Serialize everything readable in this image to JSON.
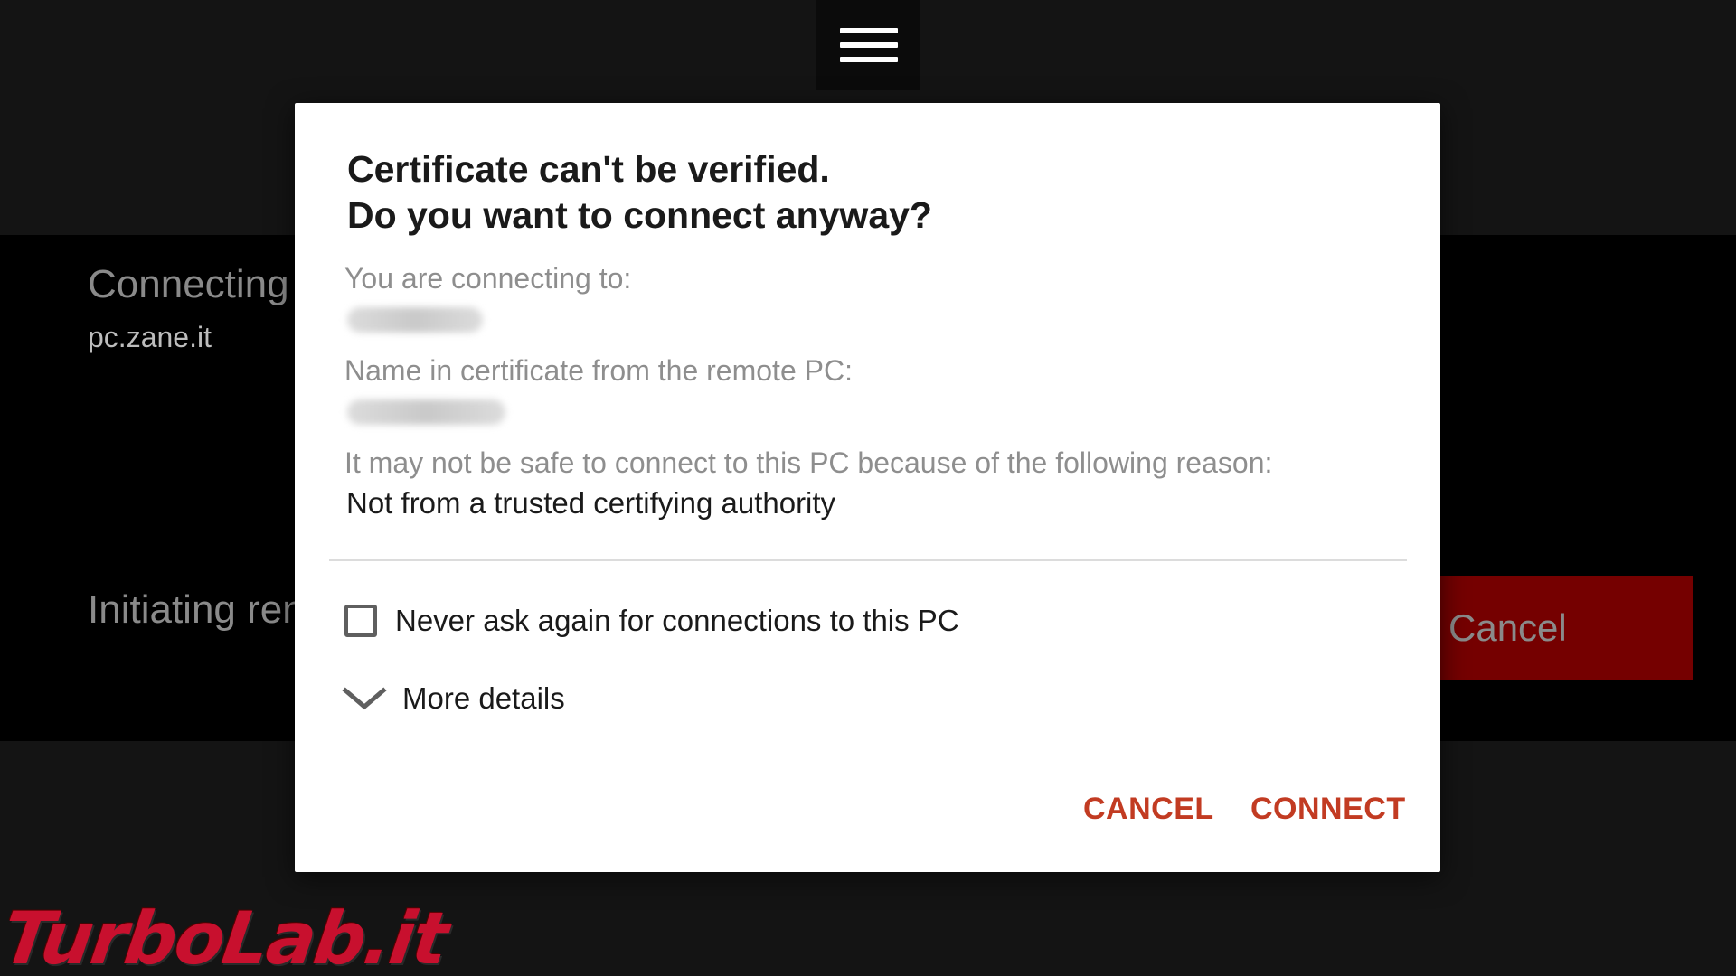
{
  "background": {
    "status_title": "Connecting",
    "status_host": "pc.zane.it",
    "status_progress": "Initiating ren",
    "cancel_label": "Cancel",
    "menu_icon": "hamburger-menu-icon"
  },
  "dialog": {
    "title_line1": "Certificate can't be verified.",
    "title_line2": "Do you want to connect anyway?",
    "connecting_to_label": "You are connecting to:",
    "cert_name_label": "Name in certificate from the remote PC:",
    "reason_label": "It may not be safe to connect to this PC because of the following reason:",
    "reason_value": "Not from a trusted certifying authority",
    "never_ask_label": "Never ask again for connections to this PC",
    "never_ask_checked": false,
    "more_details_label": "More details",
    "cancel_button": "CANCEL",
    "connect_button": "CONNECT"
  },
  "watermark": {
    "text": "TurboLab.it"
  },
  "colors": {
    "accent": "#c23b22",
    "background_panel": "#000000",
    "background_dark": "#141414",
    "cancel_bg": "#750000",
    "logo": "#c8102e"
  }
}
